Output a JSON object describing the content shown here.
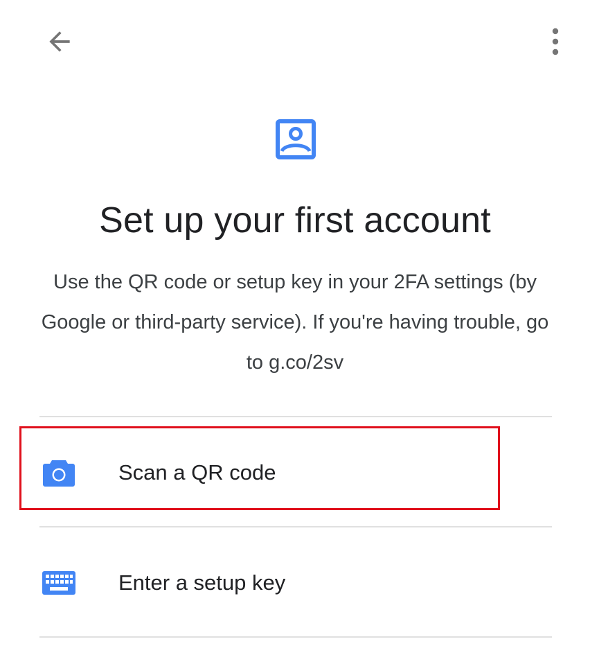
{
  "top_bar": {
    "back_icon": "arrow-back-icon",
    "more_icon": "more-vert-icon"
  },
  "header": {
    "icon": "account-box-icon",
    "title": "Set up your first account",
    "description": "Use the QR code or setup key in your 2FA settings (by Google or third-party service). If you're having trouble, go to g.co/2sv"
  },
  "options": [
    {
      "label": "Scan a QR code",
      "icon": "camera-icon"
    },
    {
      "label": "Enter a setup key",
      "icon": "keyboard-icon"
    }
  ],
  "colors": {
    "accent": "#4285f4",
    "icon_grey": "#757575",
    "highlight": "#e0101c"
  }
}
